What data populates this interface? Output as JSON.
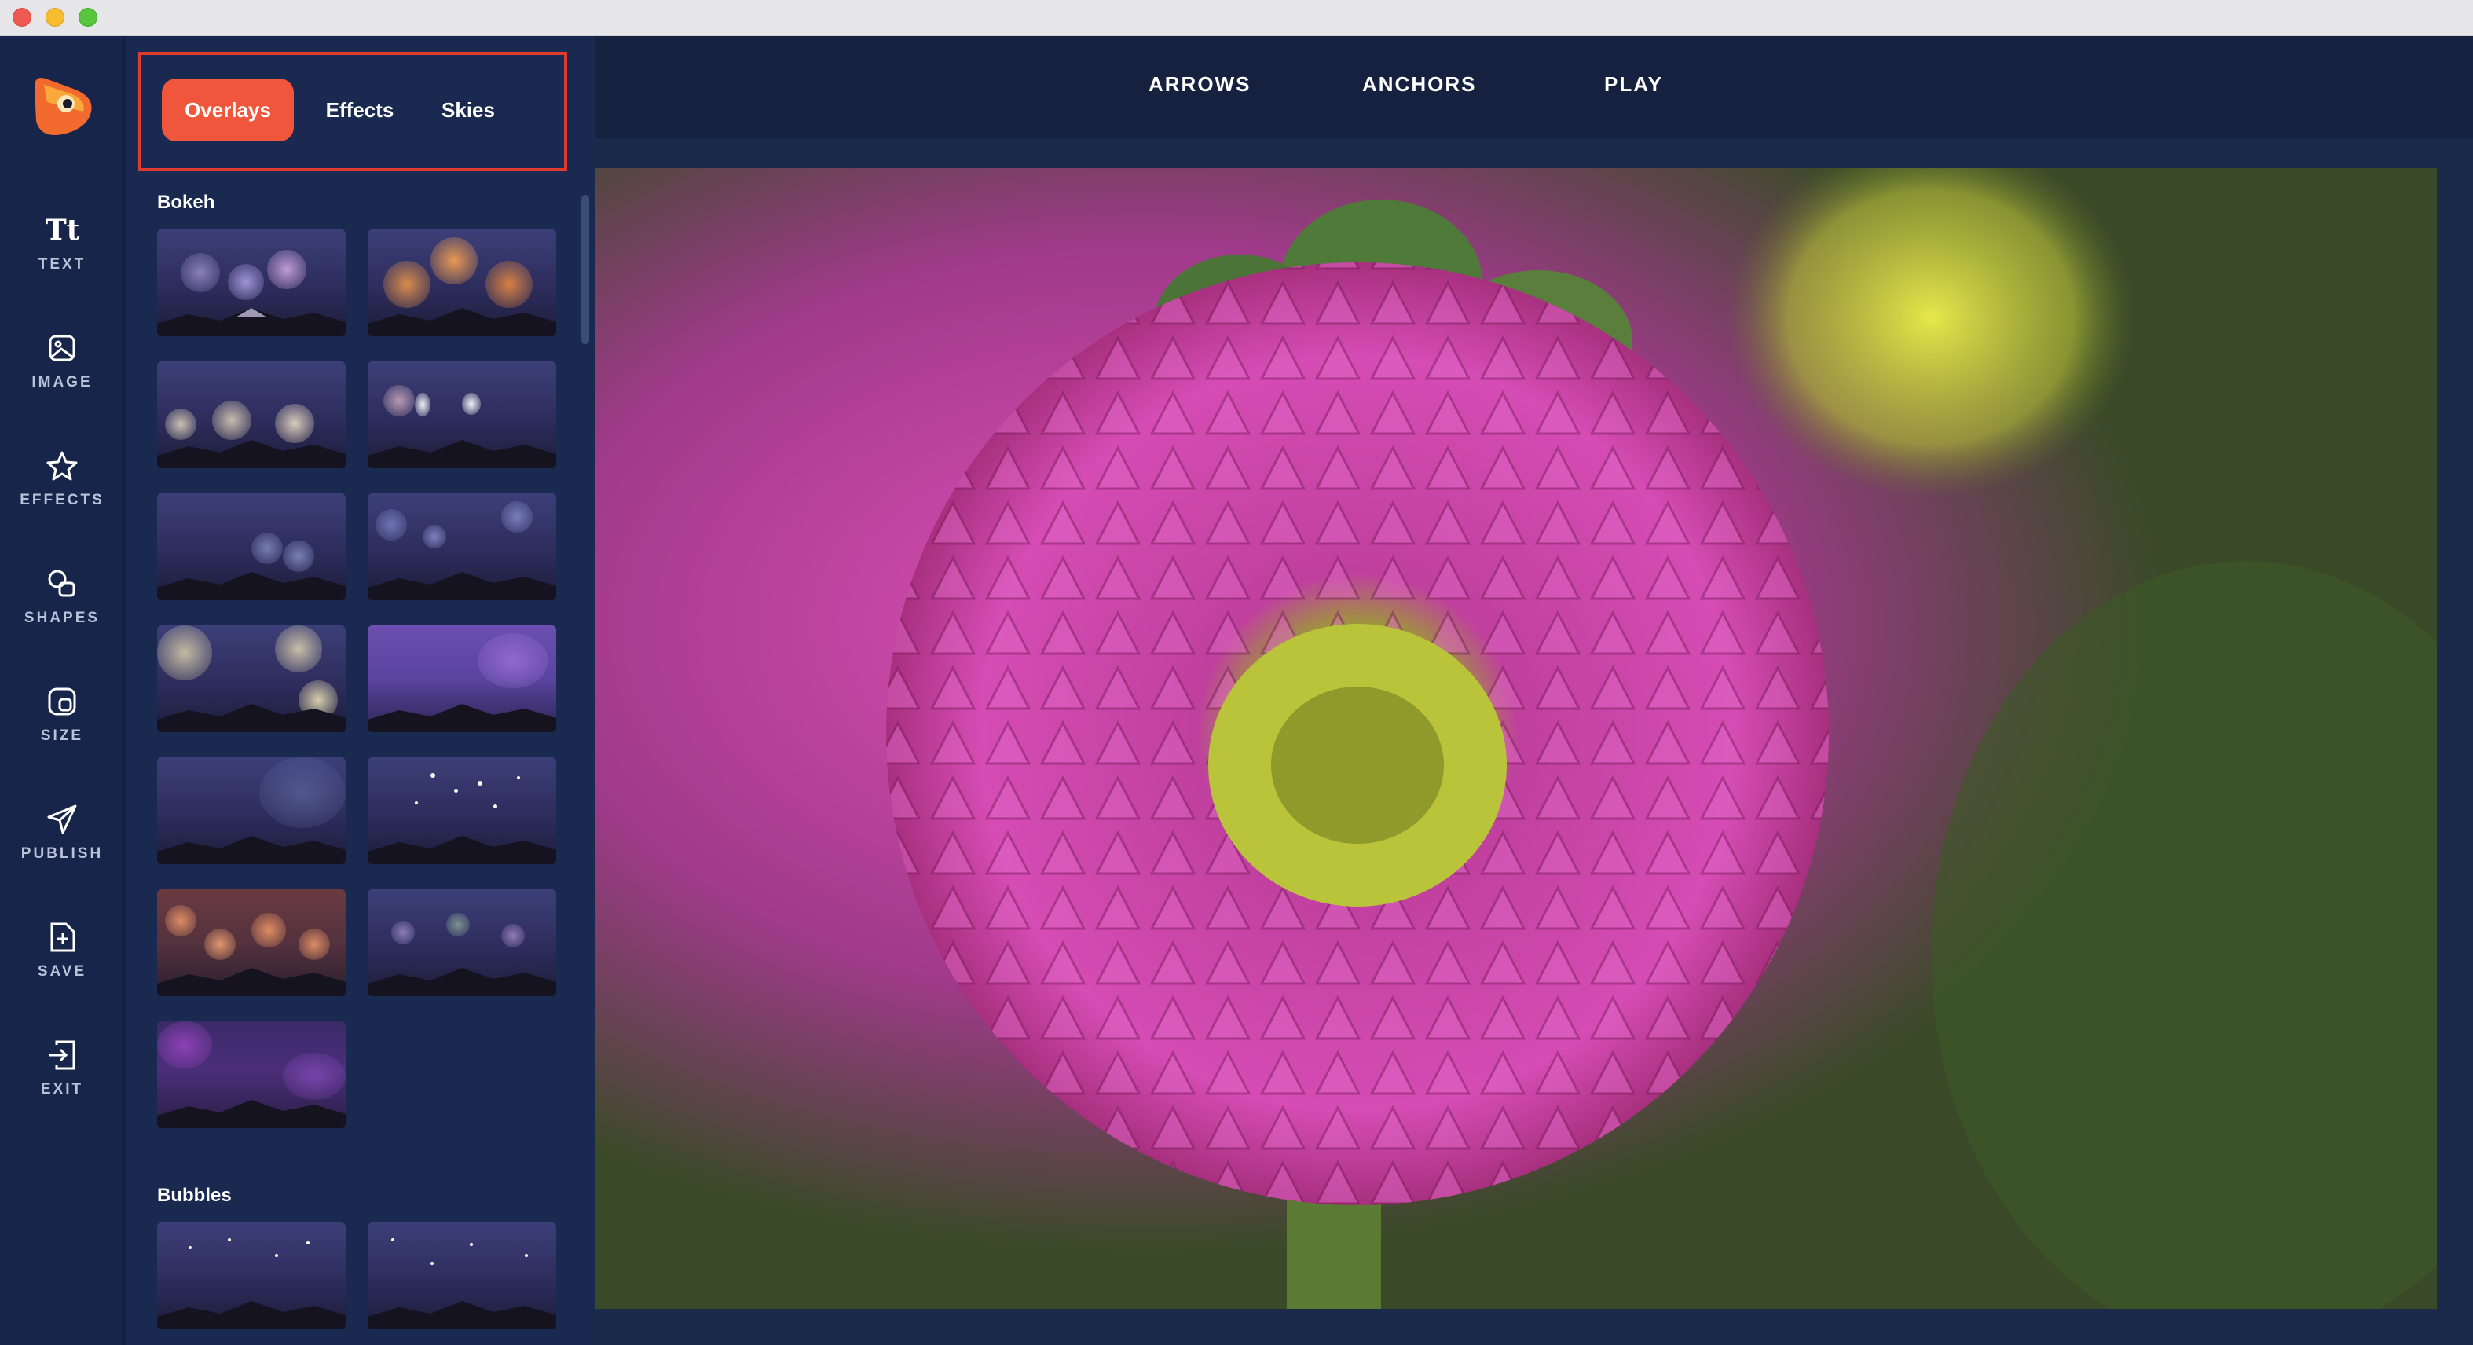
{
  "window": {
    "controls": [
      "close",
      "minimize",
      "maximize"
    ]
  },
  "rail": {
    "logo_icon": "app-logo-icon",
    "items": [
      {
        "label": "TEXT",
        "icon": "text-tt-icon"
      },
      {
        "label": "IMAGE",
        "icon": "image-icon"
      },
      {
        "label": "EFFECTS",
        "icon": "star-icon"
      },
      {
        "label": "SHAPES",
        "icon": "shapes-icon"
      },
      {
        "label": "SIZE",
        "icon": "size-icon"
      },
      {
        "label": "PUBLISH",
        "icon": "paper-plane-icon"
      },
      {
        "label": "SAVE",
        "icon": "save-plus-icon"
      },
      {
        "label": "EXIT",
        "icon": "exit-icon"
      }
    ],
    "text_glyph": "Tt"
  },
  "panel": {
    "tabs": [
      {
        "label": "Overlays",
        "active": true
      },
      {
        "label": "Effects",
        "active": false
      },
      {
        "label": "Skies",
        "active": false
      }
    ],
    "sections": [
      {
        "title": "Bokeh",
        "thumbnail_count": 13
      },
      {
        "title": "Bubbles",
        "thumbnail_count": 2
      }
    ]
  },
  "topnav": {
    "arrows": "ARROWS",
    "anchors": "ANCHORS",
    "play": "PLAY"
  },
  "colors": {
    "accent": "#f0563c",
    "highlight_border": "#e03a2f",
    "background": "#162341"
  }
}
